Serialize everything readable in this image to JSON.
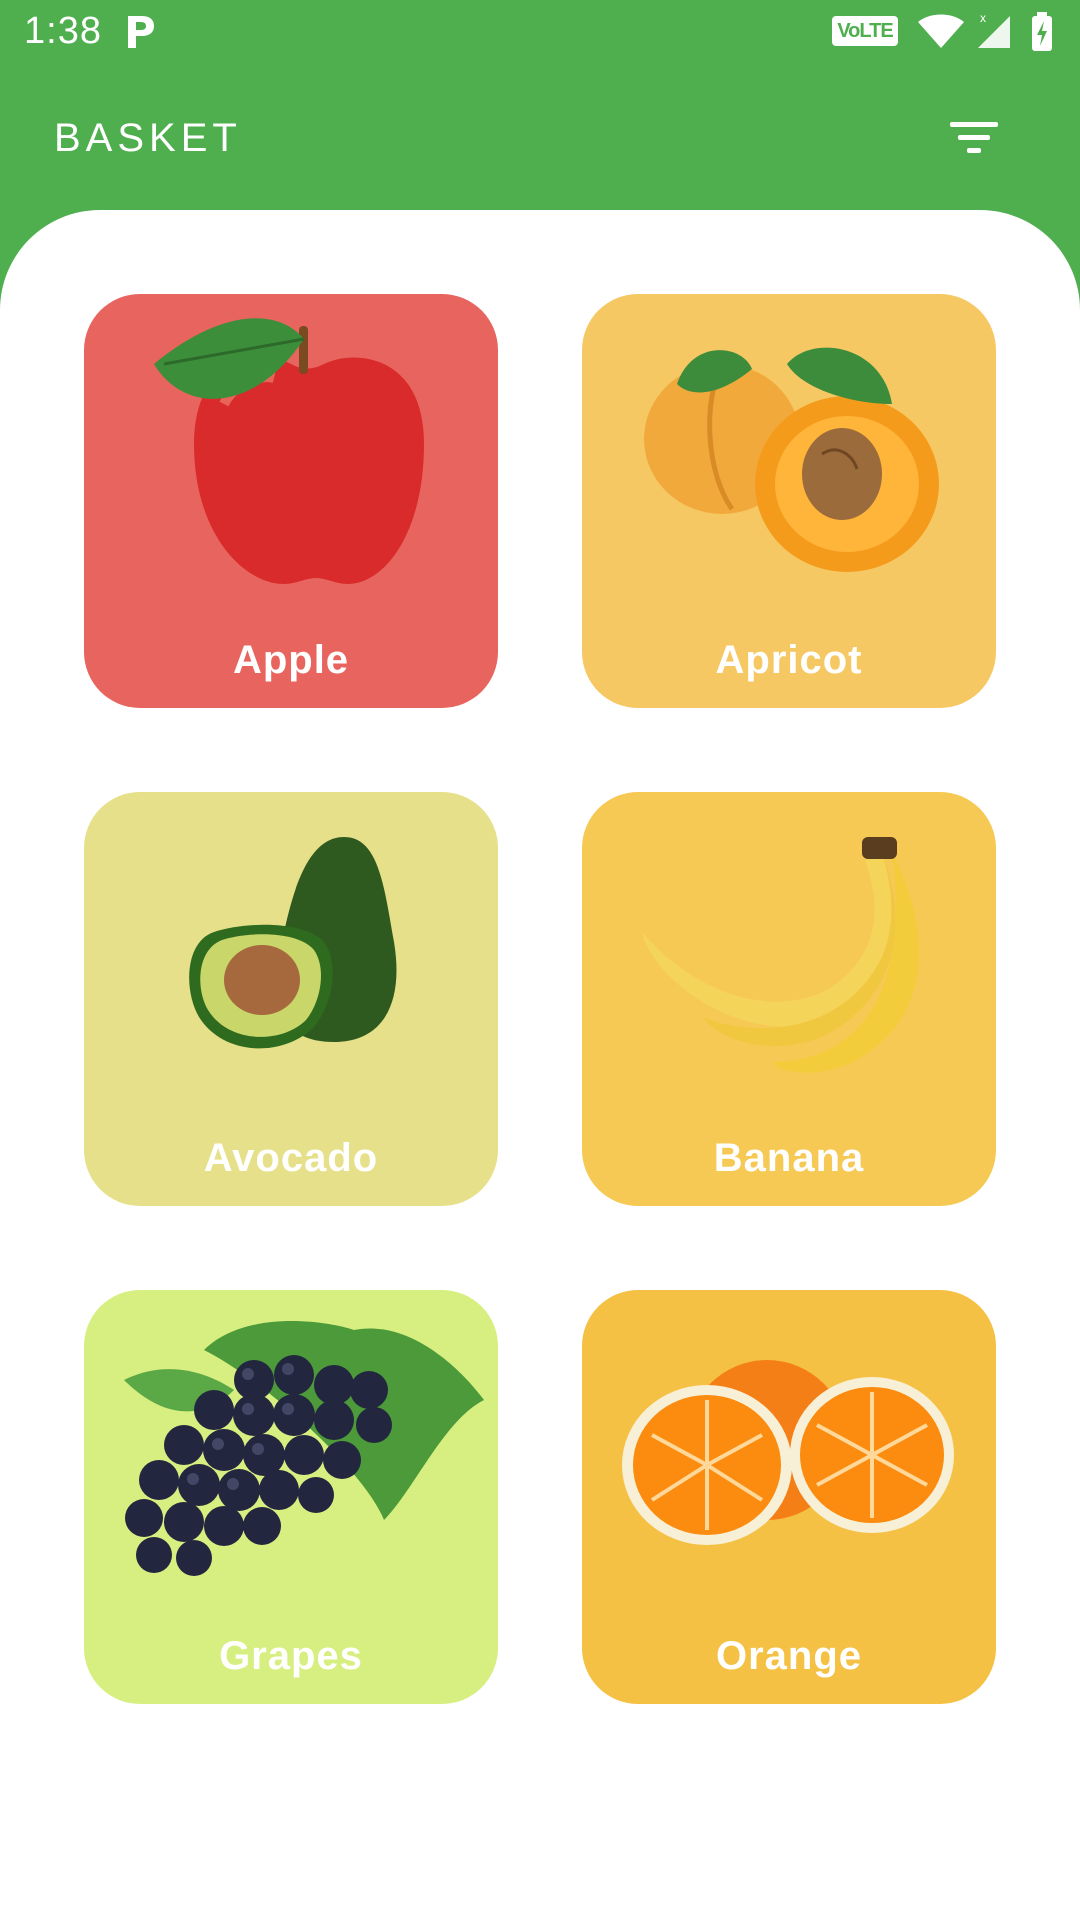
{
  "status_bar": {
    "time": "1:38",
    "network_badge": "VoLTE",
    "icons": [
      "parking-icon",
      "wifi-icon",
      "signal-icon",
      "battery-icon"
    ]
  },
  "app_bar": {
    "title": "BASKET",
    "filter_icon": "filter-icon"
  },
  "colors": {
    "primary": "#4faf4f",
    "surface": "#ffffff",
    "apple_bg": "#e8655f",
    "apricot_bg": "#f6c864",
    "avocado_bg": "#e6e08a",
    "banana_bg": "#f6c955",
    "grapes_bg": "#d7ef80",
    "orange_bg": "#f5c144"
  },
  "fruits": [
    {
      "label": "Apple",
      "icon": "apple-image"
    },
    {
      "label": "Apricot",
      "icon": "apricot-image"
    },
    {
      "label": "Avocado",
      "icon": "avocado-image"
    },
    {
      "label": "Banana",
      "icon": "banana-image"
    },
    {
      "label": "Grapes",
      "icon": "grapes-image"
    },
    {
      "label": "Orange",
      "icon": "orange-image"
    }
  ]
}
